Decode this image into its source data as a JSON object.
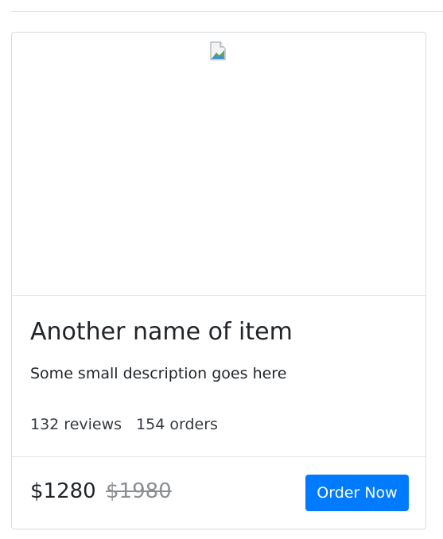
{
  "product": {
    "title": "Another name of item",
    "description": "Some small description goes here",
    "reviews": "132 reviews",
    "orders": "154 orders",
    "price": "$1280",
    "old_price": "$1980",
    "order_label": "Order Now",
    "image_icon": "broken-image-icon"
  },
  "colors": {
    "accent": "#007bff",
    "old_price": "#8a8f94",
    "border": "#d9dcdf"
  }
}
